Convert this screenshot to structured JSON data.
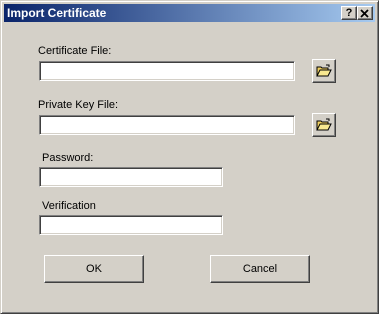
{
  "window": {
    "title": "Import Certificate",
    "help_label": "?",
    "close_label": "✕"
  },
  "form": {
    "certificate_file": {
      "label": "Certificate File:",
      "value": ""
    },
    "private_key_file": {
      "label": "Private Key File:",
      "value": ""
    },
    "password": {
      "label": "Password:",
      "value": ""
    },
    "verification": {
      "label": "Verification",
      "value": ""
    }
  },
  "buttons": {
    "ok_label": "OK",
    "cancel_label": "Cancel"
  },
  "icons": {
    "browse": "open-folder-icon"
  },
  "colors": {
    "dialog_bg": "#d4d0c8",
    "titlebar_start": "#0a246a",
    "titlebar_end": "#a6caf0",
    "folder_yellow": "#f0d060"
  }
}
